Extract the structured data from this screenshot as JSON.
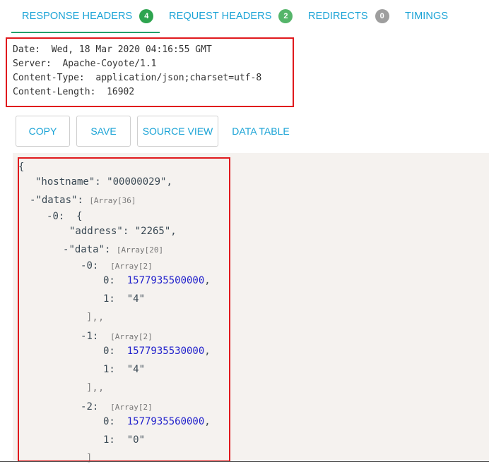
{
  "tabs": [
    {
      "label": "RESPONSE HEADERS",
      "badge": "4",
      "badge_color": "#2ea44f",
      "active": true
    },
    {
      "label": "REQUEST HEADERS",
      "badge": "2",
      "badge_color": "#55b56a"
    },
    {
      "label": "REDIRECTS",
      "badge": "0",
      "badge_color": "#9e9e9e"
    },
    {
      "label": "TIMINGS"
    }
  ],
  "headers": [
    {
      "name": "Date:",
      "value": "Wed, 18 Mar 2020 04:16:55 GMT"
    },
    {
      "name": "Server:",
      "value": "Apache-Coyote/1.1"
    },
    {
      "name": "Content-Type:",
      "value": "application/json;charset=utf-8"
    },
    {
      "name": "Content-Length:",
      "value": "16902"
    }
  ],
  "buttons": {
    "copy": "COPY",
    "save": "SAVE",
    "source_view": "SOURCE VIEW",
    "data_table": "DATA TABLE"
  },
  "json": {
    "open_brace": "{",
    "hostname_key": "\"hostname\"",
    "hostname_value": "\"00000029\"",
    "datas_key": "\"datas\"",
    "datas_type": "[Array[36]",
    "item0_index": "0",
    "address_key": "\"address\"",
    "address_value": "\"2265\"",
    "data_key": "\"data\"",
    "data_type": "[Array[20]",
    "rows": [
      {
        "index": "0",
        "type": "[Array[2]",
        "v0": "1577935500000",
        "v1": "\"4\""
      },
      {
        "index": "1",
        "type": "[Array[2]",
        "v0": "1577935530000",
        "v1": "\"4\""
      },
      {
        "index": "2",
        "type": "[Array[2]",
        "v0": "1577935560000",
        "v1": "\"0\""
      }
    ],
    "close_bracket": "],,"
  },
  "colors": {
    "accent": "#1aa3d6",
    "active_underline": "#22a06b",
    "highlight_border": "#e0191d",
    "json_background": "#f5f2ef",
    "number": "#2222cc"
  }
}
